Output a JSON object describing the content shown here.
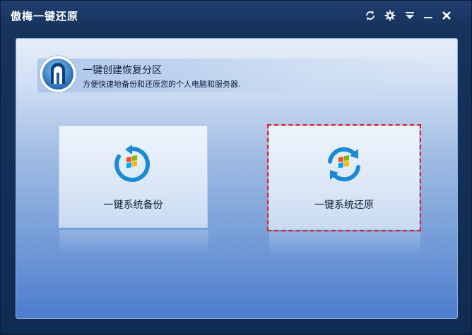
{
  "window": {
    "title": "傲梅一键还原",
    "controls": [
      "refresh-icon",
      "gear-icon",
      "menu-icon",
      "minimize-icon",
      "close-icon"
    ]
  },
  "banner": {
    "title": "一键创建恢复分区",
    "subtitle": "方便快速地备份和还原您的个人电脑和服务器."
  },
  "cards": [
    {
      "label": "一键系统备份",
      "icon": "backup-icon"
    },
    {
      "label": "一键系统还原",
      "icon": "restore-icon",
      "selected": true
    }
  ],
  "colors": {
    "accent": "#1a8ad4",
    "highlight": "#e81b1b",
    "titlebar": "#15325c"
  }
}
